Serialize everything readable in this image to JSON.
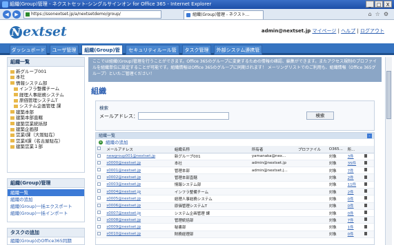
{
  "window": {
    "title": "組織(Group)管理 - ネクストセット-シングルサインオン for Office 365 - Internet Explorer",
    "buttons": [
      "_",
      "□",
      "X"
    ]
  },
  "browser": {
    "url": "https://ssonextset.jp/a/nextsetdemo/group/",
    "tab_title": "組織(Group)管理 - ネクスト..."
  },
  "header": {
    "logo": "extset",
    "user": "admin@nextset.jp",
    "links": [
      "マイページ",
      "ヘルプ",
      "ログアウト"
    ],
    "separator": "|"
  },
  "nav": {
    "items": [
      "ダッシュボード",
      "ユーザ管理",
      "組織(Group)管理",
      "セキュリティルール管理",
      "タスク管理",
      "外部システム連携管理"
    ]
  },
  "sidebar": {
    "org_list": {
      "title": "組織一覧",
      "items": [
        "新グループ001",
        "本社",
        "情報システム部",
        "インフラ整備チーム",
        "経理人事総務システム",
        "原価管理システムT",
        "システム企画管理 課",
        "建築本部",
        "建築本部直轄",
        "建築営業統括部",
        "建築企画部",
        "営業Ⅰ課（大阪駐在）",
        "営業Ⅱ課（名古屋駐在）",
        "建築営業１部"
      ]
    },
    "group_admin": {
      "title": "組織(Group)管理",
      "items": [
        "組織一覧",
        "組織の追加",
        "組織(Group)一括エクスポート",
        "組織(Group)一括インポート"
      ]
    },
    "task_add": {
      "title": "タスクの追加",
      "items": [
        "組織(Group)のOffice365同期"
      ]
    }
  },
  "main": {
    "notice": "ここでは組織(Group)管理を行うことができます。Office 365のグループに変更するための情報の確認、編集ができます。またアクセス規制のプロファイルを組織単位に設定することが可能です。組織情報はOffice 365のグループに同期されます！ メーリングリストでのご利用も、組織情報（Office 365グループ）といたご管理ください！",
    "title": "組織",
    "search": {
      "heading": "検索",
      "label": "メールアドレス：",
      "button": "検索",
      "value": ""
    },
    "list": {
      "heading": "組織一覧",
      "add": "組織の追加",
      "columns": [
        "",
        "メールアドレス",
        "組織名称",
        "所有者",
        "プロファイル",
        "O365...",
        "所...",
        ""
      ],
      "rows": [
        [
          "newgroup001@nextset.jp",
          "新グループ001",
          "yamanaka@nex...",
          "",
          "対象",
          "3件"
        ],
        [
          "s0000@nextset.jp",
          "本社",
          "admin@nextset.jp",
          "",
          "対象",
          "35件"
        ],
        [
          "s0001@nextset.jp",
          "管理本部",
          "admin@nextset.j...",
          "",
          "対象",
          "7件"
        ],
        [
          "s0002@nextset.jp",
          "管理本部直轄",
          "",
          "",
          "対象",
          "2件"
        ],
        [
          "s0003@nextset.jp",
          "情報システム部",
          "",
          "",
          "対象",
          "11件"
        ],
        [
          "s0004@nextset.jp",
          "インフラ整備チーム",
          "",
          "",
          "対象",
          "2件"
        ],
        [
          "s0005@nextset.jp",
          "経理人事総務システム",
          "",
          "",
          "対象",
          "0件"
        ],
        [
          "s0006@nextset.jp",
          "原価管理システムT",
          "",
          "",
          "対象",
          "0件"
        ],
        [
          "s0007@nextset.jp",
          "システム企画管理 課",
          "",
          "",
          "対象",
          "0件"
        ],
        [
          "s0008@nextset.jp",
          "管理統括部",
          "",
          "",
          "対象",
          "7件"
        ],
        [
          "s0009@nextset.jp",
          "秘書部",
          "",
          "",
          "対象",
          "1件"
        ],
        [
          "s0010@nextset.jp",
          "財務経理部",
          "",
          "",
          "対象",
          "0件"
        ]
      ]
    }
  }
}
